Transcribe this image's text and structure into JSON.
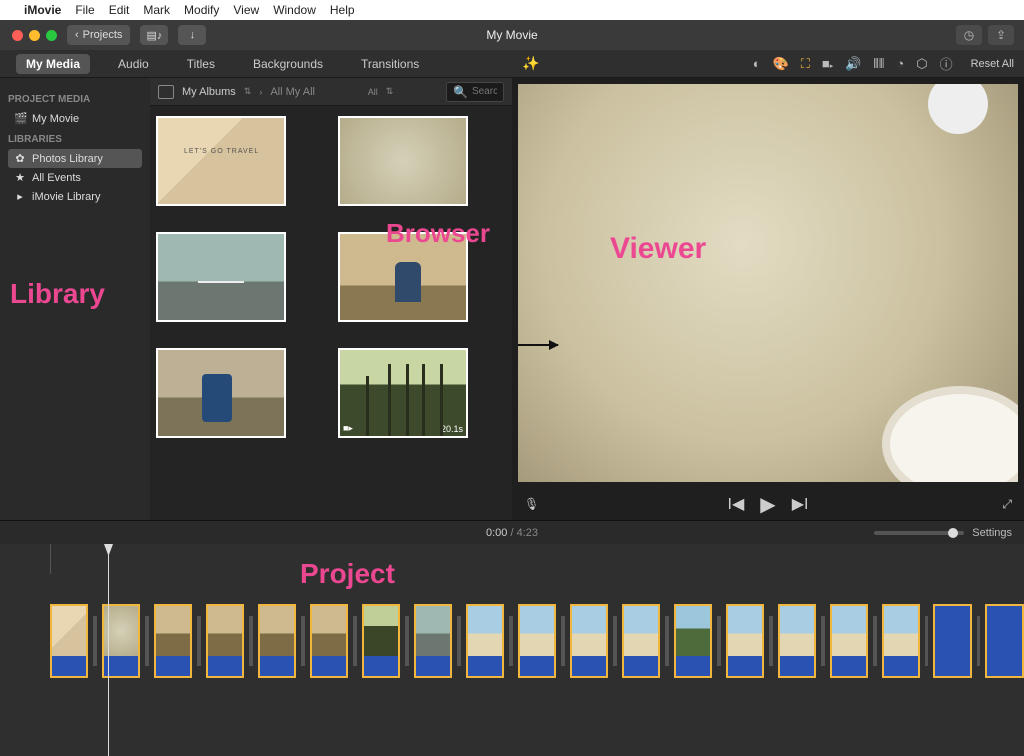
{
  "menubar": {
    "app": "iMovie",
    "items": [
      "File",
      "Edit",
      "Mark",
      "Modify",
      "View",
      "Window",
      "Help"
    ]
  },
  "toolbar": {
    "back_label": "Projects",
    "title": "My Movie"
  },
  "media_tabs": [
    "My Media",
    "Audio",
    "Titles",
    "Backgrounds",
    "Transitions"
  ],
  "media_tabs_active": "My Media",
  "sidebar": {
    "section1": "PROJECT MEDIA",
    "project": "My Movie",
    "section2": "LIBRARIES",
    "items": [
      {
        "icon": "flower-icon",
        "label": "Photos Library",
        "selected": true
      },
      {
        "icon": "star-icon",
        "label": "All Events",
        "selected": false
      },
      {
        "icon": "triangle-icon",
        "label": "iMovie Library",
        "selected": false
      }
    ]
  },
  "browser": {
    "crumb1": "My Albums",
    "crumb2": "All My All",
    "filter": "All",
    "search_placeholder": "Search",
    "clips": [
      {
        "name": "travel-poster",
        "art": "art-travel",
        "duration": ""
      },
      {
        "name": "map-photo",
        "art": "art-map",
        "duration": ""
      },
      {
        "name": "road-photo",
        "art": "art-road",
        "duration": ""
      },
      {
        "name": "tuk-photo",
        "art": "art-tuk",
        "duration": ""
      },
      {
        "name": "tuk2-photo",
        "art": "art-tuk2",
        "duration": ""
      },
      {
        "name": "trees-video",
        "art": "art-trees",
        "duration": "20.1s",
        "video": true
      }
    ]
  },
  "adjust": {
    "reset": "Reset All",
    "icons": [
      "contrast-icon",
      "color-wheel-icon",
      "crop-icon",
      "camera-icon",
      "volume-icon",
      "equalizer-icon",
      "speed-icon",
      "stabilize-icon",
      "info-icon"
    ]
  },
  "playback": {
    "current": "0:00",
    "total": "4:23",
    "settings": "Settings"
  },
  "annotations": {
    "library": "Library",
    "browser": "Browser",
    "viewer": "Viewer",
    "project": "Project"
  },
  "timeline": {
    "clips": [
      "cv-travel",
      "cv-map",
      "cv-tuk",
      "cv-tuk",
      "cv-tuk",
      "cv-tuk",
      "cv-trees",
      "cv-road",
      "cv-beach",
      "cv-beach",
      "cv-beach",
      "cv-beach",
      "cv-palm",
      "cv-beach",
      "cv-beach",
      "cv-beach",
      "cv-beach",
      "cv-blue",
      "cv-blue"
    ]
  }
}
